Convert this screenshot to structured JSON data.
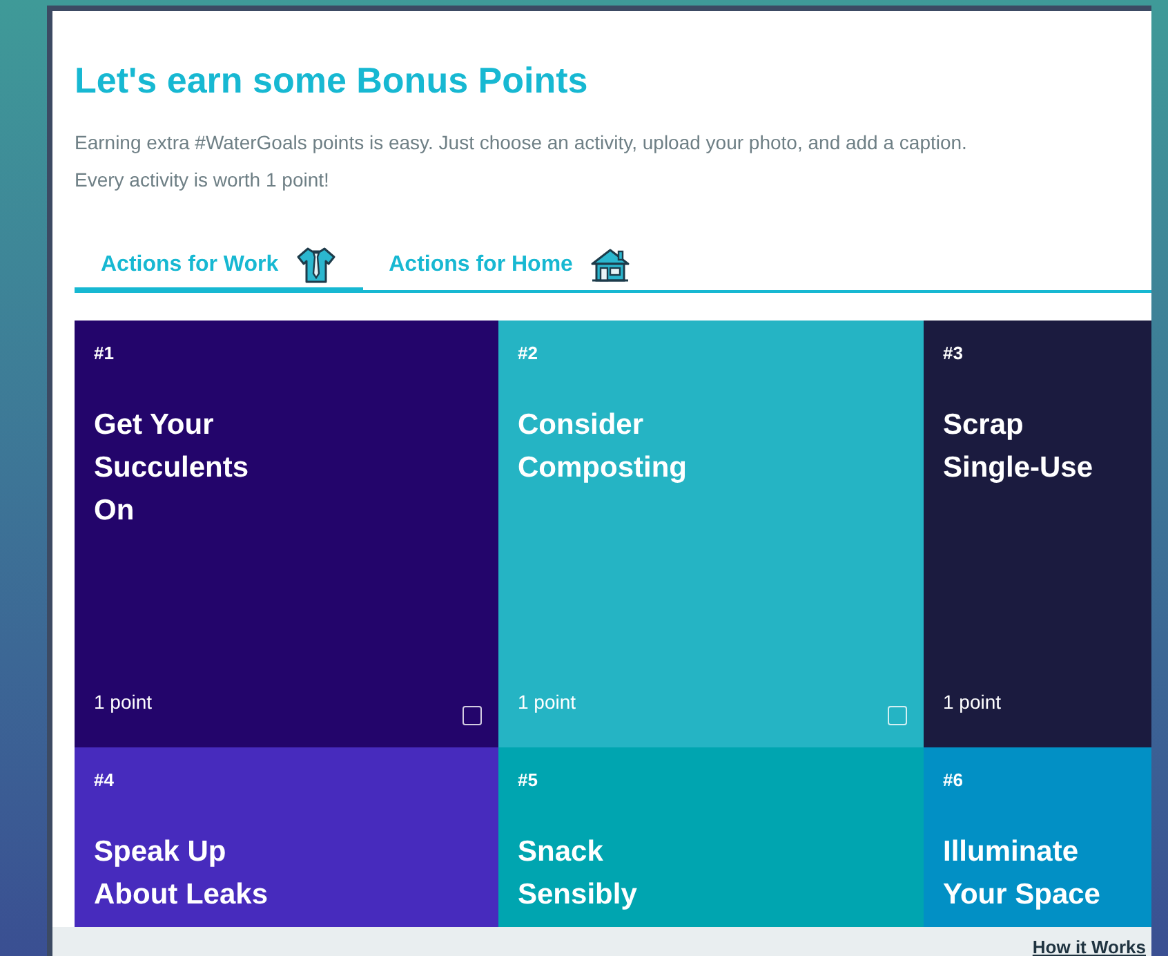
{
  "title": "Let's earn some Bonus Points",
  "intro": [
    "Earning extra #WaterGoals points is easy. Just choose an activity, upload your photo, and add a caption.",
    "Every activity is worth 1 point!"
  ],
  "tabs": [
    {
      "label": "Actions for Work",
      "kind": "work",
      "selected": true
    },
    {
      "label": "Actions for Home",
      "kind": "home",
      "selected": false
    }
  ],
  "cards": [
    {
      "number": "#1",
      "title": [
        "Get Your",
        "Succulents",
        "On"
      ],
      "points": "1 point",
      "color": "#23056b",
      "checked": false
    },
    {
      "number": "#2",
      "title": [
        "Consider",
        "Composting"
      ],
      "points": "1 point",
      "color": "#25b4c4",
      "checked": false
    },
    {
      "number": "#3",
      "title": [
        "Scrap",
        "Single-Use"
      ],
      "points": "1 point",
      "color": "#1b1b3f"
    },
    {
      "number": "#4",
      "title": [
        "Speak Up",
        "About Leaks"
      ],
      "color": "#472bbd"
    },
    {
      "number": "#5",
      "title": [
        "Snack",
        "Sensibly"
      ],
      "color": "#00a5b0"
    },
    {
      "number": "#6",
      "title": [
        "Illuminate",
        "Your Space"
      ],
      "color": "#0290c5"
    }
  ],
  "footer_link": "How it Works"
}
